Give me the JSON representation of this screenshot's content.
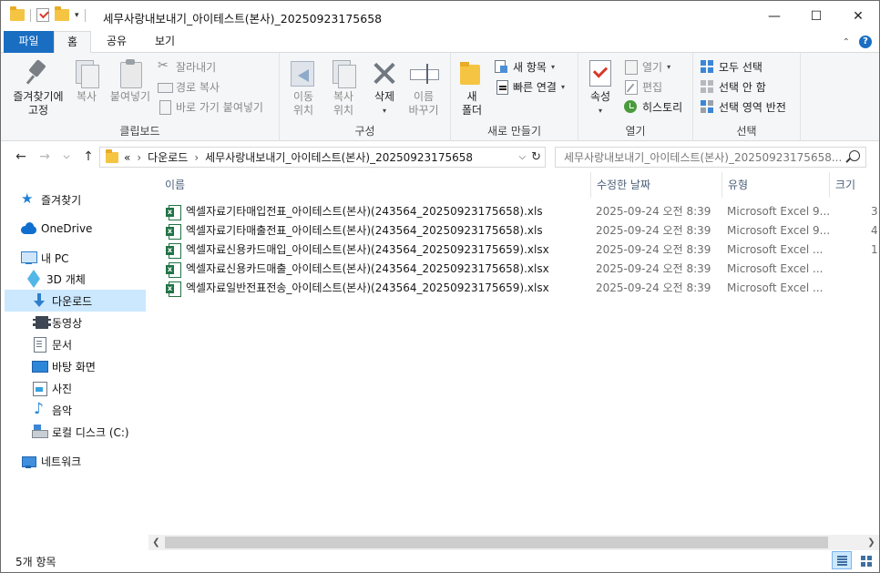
{
  "window": {
    "title": "세무사랑내보내기_아이테스트(본사)_20250923175658",
    "min_glyph": "—",
    "max_glyph": "☐",
    "close_glyph": "✕"
  },
  "ribbon_tabs": {
    "file": "파일",
    "home": "홈",
    "share": "공유",
    "view": "보기",
    "help": "?"
  },
  "ribbon": {
    "clipboard": {
      "label": "클립보드",
      "pin": "즐겨찾기에\n고정",
      "copy": "복사",
      "paste": "붙여넣기",
      "cut": "잘라내기",
      "copy_path": "경로 복사",
      "paste_shortcut": "바로 가기 붙여넣기"
    },
    "organize": {
      "label": "구성",
      "move_to": "이동\n위치",
      "copy_to": "복사\n위치",
      "delete": "삭제",
      "rename": "이름\n바꾸기"
    },
    "new": {
      "label": "새로 만들기",
      "new_folder": "새\n폴더",
      "new_item": "새 항목",
      "easy_access": "빠른 연결"
    },
    "open": {
      "label": "열기",
      "properties": "속성",
      "open": "열기",
      "edit": "편집",
      "history": "히스토리"
    },
    "select": {
      "label": "선택",
      "select_all": "모두 선택",
      "select_none": "선택 안 함",
      "invert": "선택 영역 반전"
    }
  },
  "address": {
    "overflow": "«",
    "crumbs": [
      "다운로드",
      "세무사랑내보내기_아이테스트(본사)_20250923175658"
    ],
    "refresh": "↻",
    "dropdown": "⌵"
  },
  "search": {
    "placeholder": "세무사랑내보내기_아이테스트(본사)_20250923175658..."
  },
  "nav_pane": {
    "items": [
      {
        "label": "즐겨찾기",
        "icon": "star-icon"
      },
      {
        "label": "OneDrive",
        "icon": "cloud-icon"
      },
      {
        "label": "내 PC",
        "icon": "pc-icon"
      },
      {
        "label": "3D 개체",
        "icon": "cube-icon"
      },
      {
        "label": "다운로드",
        "icon": "download-icon"
      },
      {
        "label": "동영상",
        "icon": "film-icon"
      },
      {
        "label": "문서",
        "icon": "document-icon"
      },
      {
        "label": "바탕 화면",
        "icon": "desktop-icon"
      },
      {
        "label": "사진",
        "icon": "picture-icon"
      },
      {
        "label": "음악",
        "icon": "music-icon"
      },
      {
        "label": "로컬 디스크 (C:)",
        "icon": "disk-icon"
      },
      {
        "label": "네트워크",
        "icon": "network-icon"
      }
    ]
  },
  "columns": {
    "name": "이름",
    "modified": "수정한 날짜",
    "type": "유형",
    "size": "크기"
  },
  "files": [
    {
      "name": "엑셀자료기타매입전표_아이테스트(본사)(243564_20250923175658).xls",
      "modified": "2025-09-24 오전 8:39",
      "type": "Microsoft Excel 9...",
      "size": "3"
    },
    {
      "name": "엑셀자료기타매출전표_아이테스트(본사)(243564_20250923175658).xls",
      "modified": "2025-09-24 오전 8:39",
      "type": "Microsoft Excel 9...",
      "size": "4"
    },
    {
      "name": "엑셀자료신용카드매입_아이테스트(본사)(243564_20250923175659).xlsx",
      "modified": "2025-09-24 오전 8:39",
      "type": "Microsoft Excel ...",
      "size": "1"
    },
    {
      "name": "엑셀자료신용카드매출_아이테스트(본사)(243564_20250923175658).xlsx",
      "modified": "2025-09-24 오전 8:39",
      "type": "Microsoft Excel ...",
      "size": ""
    },
    {
      "name": "엑셀자료일반전표전송_아이테스트(본사)(243564_20250923175659).xlsx",
      "modified": "2025-09-24 오전 8:39",
      "type": "Microsoft Excel ...",
      "size": ""
    }
  ],
  "status": {
    "count": "5개 항목"
  },
  "colors": {
    "accent": "#1a6ec2",
    "selection": "#cce8ff",
    "excel": "#217346"
  }
}
